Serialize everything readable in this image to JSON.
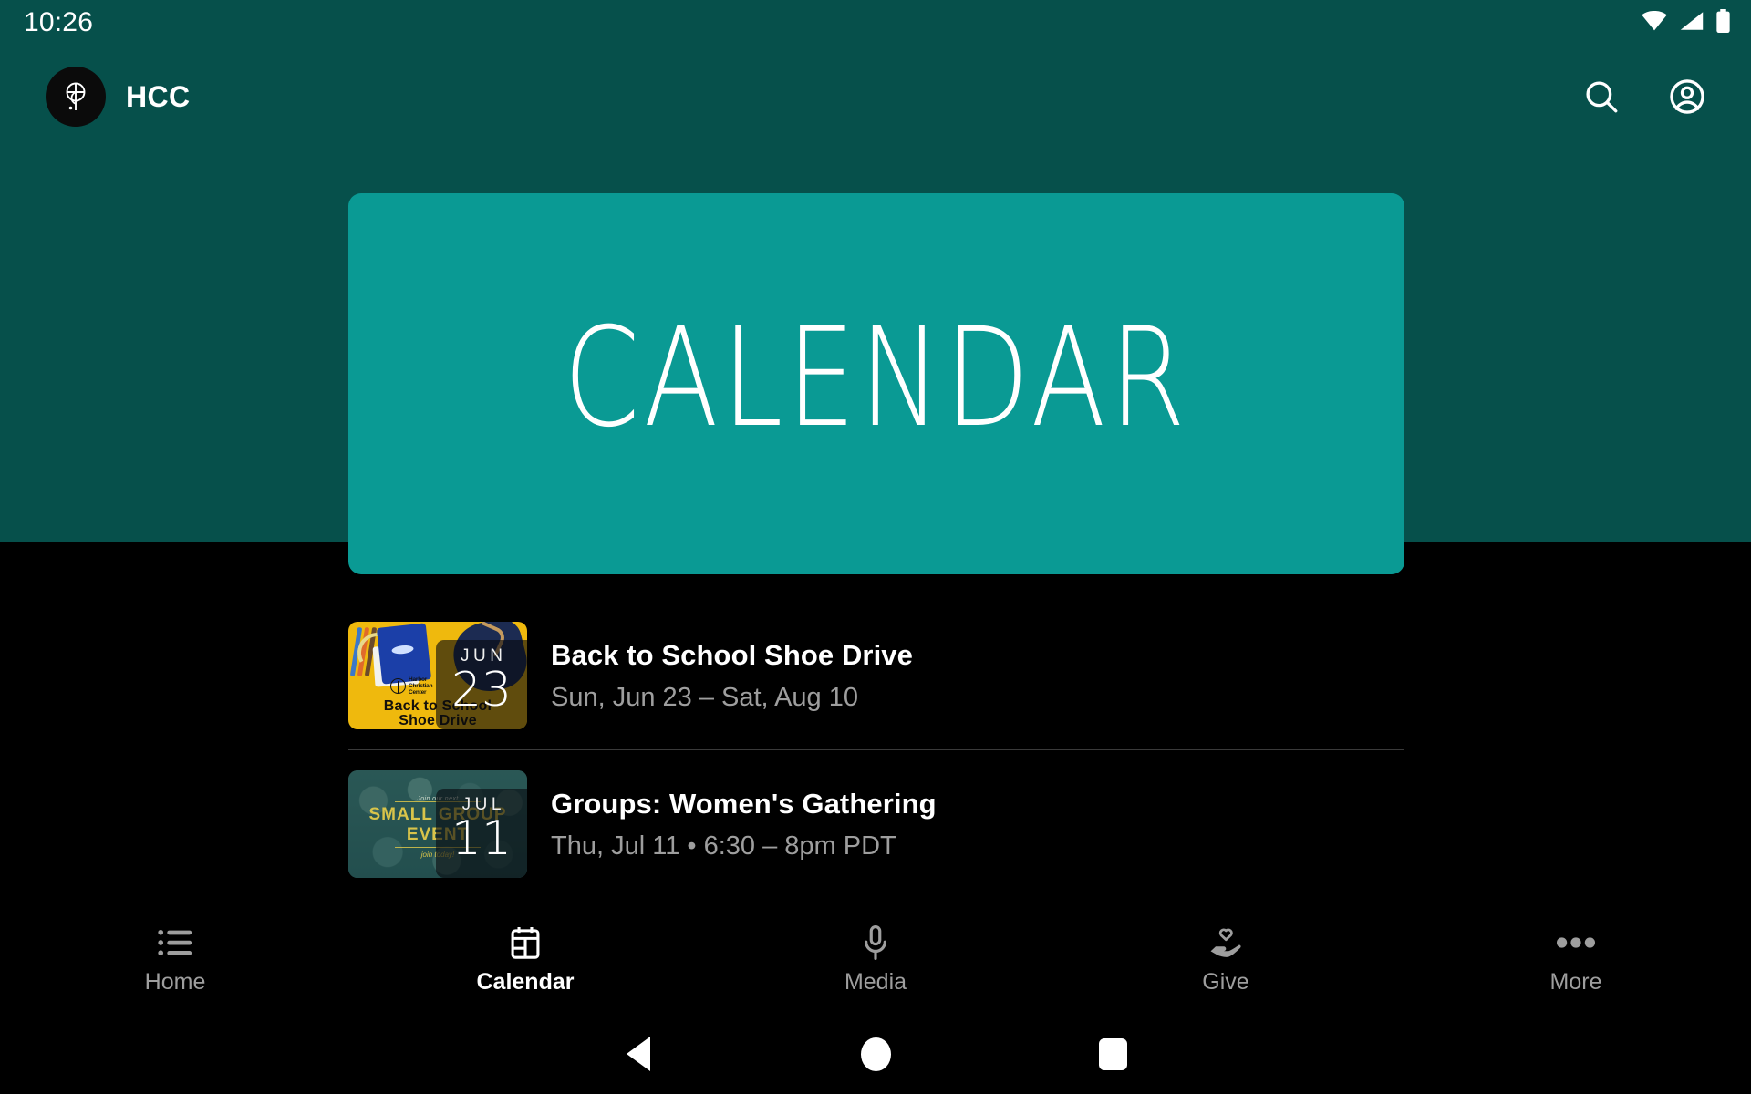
{
  "status_bar": {
    "time": "10:26",
    "icons": [
      "wifi-icon",
      "cellular-signal-icon",
      "battery-icon"
    ]
  },
  "app_bar": {
    "logo_icon": "harbor-christian-center-logo",
    "brand_name": "HCC",
    "search_icon": "search-icon",
    "account_icon": "account-circle-icon"
  },
  "hero": {
    "title": "CALENDAR",
    "background_color": "#0A9A94"
  },
  "theme": {
    "header_background": "#06504B",
    "page_background": "#000000",
    "accent": "#0A9A94",
    "muted_text": "#9E9E9E"
  },
  "events": [
    {
      "title": "Back to School Shoe Drive",
      "meta": "Sun, Jun 23 – Sat, Aug 10",
      "badge_month": "JUN",
      "badge_day": "23",
      "thumb_line1": "Back to School",
      "thumb_line2": "Shoe Drive",
      "thumb_crest": "Harbor\nChristian\nCenter",
      "thumb_background": "#EFB90D"
    },
    {
      "title": "Groups: Women's Gathering",
      "meta": "Thu, Jul 11 • 6:30 – 8pm PDT",
      "badge_month": "JUL",
      "badge_day": "11",
      "thumb_top": "Join our next",
      "thumb_line1": "SMALL GROUP",
      "thumb_line2": "EVENT",
      "thumb_bottom": "join today!",
      "thumb_background": "#2a4b4c"
    }
  ],
  "tabs": [
    {
      "label": "Home",
      "icon": "list-icon",
      "active": false
    },
    {
      "label": "Calendar",
      "icon": "calendar-icon",
      "active": true
    },
    {
      "label": "Media",
      "icon": "microphone-icon",
      "active": false
    },
    {
      "label": "Give",
      "icon": "hand-heart-icon",
      "active": false
    },
    {
      "label": "More",
      "icon": "more-dots-icon",
      "active": false
    }
  ],
  "system_nav": {
    "back": "back-triangle-icon",
    "home": "home-circle-icon",
    "recents": "recents-square-icon"
  }
}
